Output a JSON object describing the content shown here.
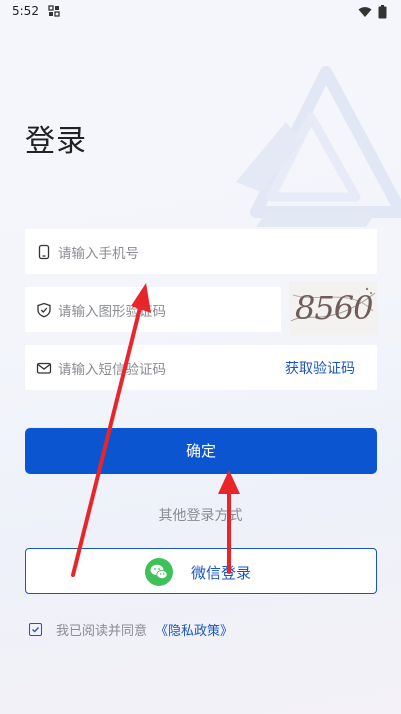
{
  "status_bar": {
    "time": "5:52",
    "notification_icon": "grid-notification-icon",
    "wifi_icon": "wifi-icon",
    "battery_icon": "battery-icon"
  },
  "page": {
    "title": "登录"
  },
  "form": {
    "phone_placeholder": "请输入手机号",
    "captcha_placeholder": "请输入图形验证码",
    "captcha_image_text": "8560",
    "sms_placeholder": "请输入短信验证码",
    "get_code_label": "获取验证码",
    "confirm_label": "确定"
  },
  "other_login": {
    "label": "其他登录方式",
    "wechat_label": "微信登录"
  },
  "agreement": {
    "text": "我已阅读并同意",
    "link": "《隐私政策》",
    "checked": true
  },
  "colors": {
    "primary": "#0b56d0",
    "link": "#1b55c2",
    "wechat": "#3fc15a",
    "annotation_arrow": "#e8262a"
  }
}
